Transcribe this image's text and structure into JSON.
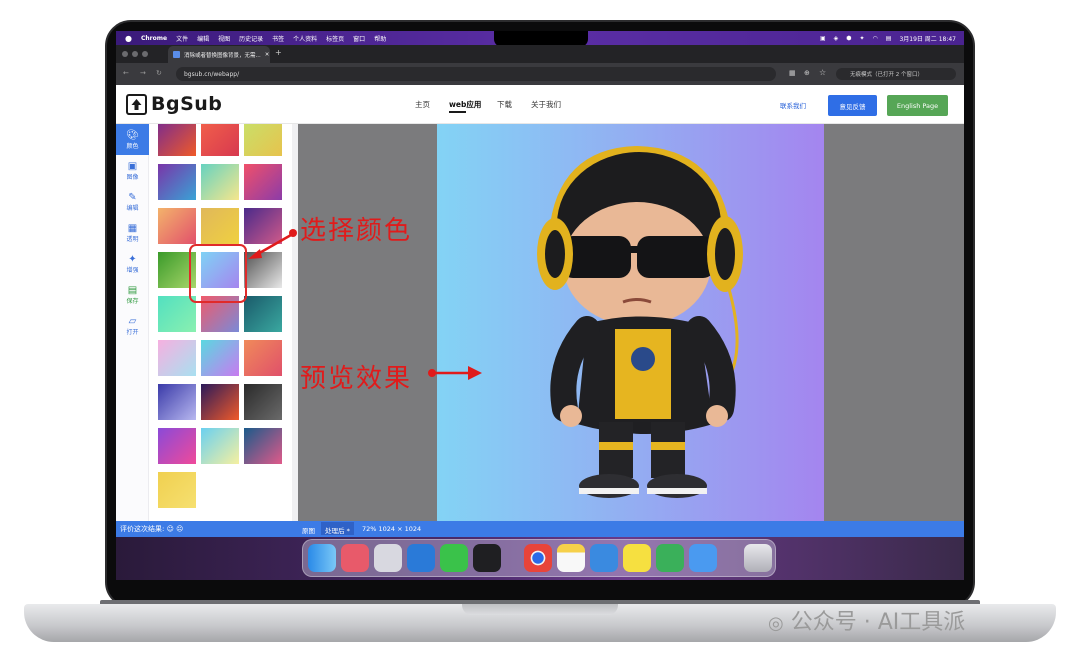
{
  "menubar": {
    "apple": "",
    "items": [
      "Chrome",
      "文件",
      "编辑",
      "视图",
      "历史记录",
      "书签",
      "个人资料",
      "标签页",
      "窗口",
      "帮助"
    ],
    "clock": "3月19日 周二 18:47"
  },
  "browser": {
    "tab_title": "消除或者替换图像背景，无需...",
    "address": "bgsub.cn/webapp/",
    "incognito": "无痕模式（已打开 2 个窗口）"
  },
  "site": {
    "logo": "BgSub",
    "nav": [
      "主页",
      "web应用",
      "下载",
      "关于我们"
    ],
    "active_nav": "web应用",
    "contact": "联系我们",
    "feedback": "意见反馈",
    "english": "English Page"
  },
  "sidebar": {
    "items": [
      {
        "label": "颜色",
        "icon": "palette-icon"
      },
      {
        "label": "图像",
        "icon": "image-icon"
      },
      {
        "label": "编辑",
        "icon": "pencil-icon"
      },
      {
        "label": "透明",
        "icon": "transparency-grid-icon"
      },
      {
        "label": "增强",
        "icon": "sparkle-icon"
      },
      {
        "label": "保存",
        "icon": "save-icon"
      },
      {
        "label": "打开",
        "icon": "folder-open-icon"
      }
    ]
  },
  "swatches": [
    [
      "#7a2b8f",
      "#f05a28"
    ],
    [
      "#f2604a",
      "#d7394f"
    ],
    [
      "#c8e06a",
      "#e7c34d"
    ],
    [
      "#7a35a8",
      "#39a3d6"
    ],
    [
      "#66d2c0",
      "#f6e68c"
    ],
    [
      "#f0506a",
      "#8c3ca8"
    ],
    [
      "#f3b36b",
      "#e2506b"
    ],
    [
      "#e0b85a",
      "#f0d040"
    ],
    [
      "#4a2a8a",
      "#d05a8a"
    ],
    [
      "#3a9a2a",
      "#a8d66a"
    ],
    [
      "#7fd2f5",
      "#a585ef"
    ],
    [
      "#505050",
      "#e8e8e8"
    ],
    [
      "#52e0c0",
      "#8af0b0"
    ],
    [
      "#f05a6a",
      "#7a8ad8"
    ],
    [
      "#1a5a6a",
      "#3aa8a0"
    ],
    [
      "#f6b0e0",
      "#a8e0f0"
    ],
    [
      "#5ad8e0",
      "#c87af0"
    ],
    [
      "#f08a5a",
      "#e0506a"
    ],
    [
      "#3a3aa8",
      "#b8b8f0"
    ],
    [
      "#2a1a5a",
      "#f05a2a"
    ],
    [
      "#2a2a2a",
      "#6a6a6a"
    ],
    [
      "#8a4ad8",
      "#f04a9a"
    ],
    [
      "#6ad0f0",
      "#f6f0a0"
    ],
    [
      "#1a5a8a",
      "#e05a8a"
    ],
    [
      "#f0d050",
      "#f6e070"
    ]
  ],
  "status": {
    "rate": "评价这次结果:",
    "original": "原图",
    "processed": "处理后 *",
    "zoom": "72% 1024 × 1024"
  },
  "annotations": {
    "select_color": "选择颜色",
    "preview_effect": "预览效果"
  },
  "watermark": "公众号 · AI工具派",
  "colors": {
    "accent_blue": "#3c7be6",
    "annotation_red": "#e01b1b",
    "english_green": "#56a656",
    "canvas_gray": "#7b7b7d"
  }
}
